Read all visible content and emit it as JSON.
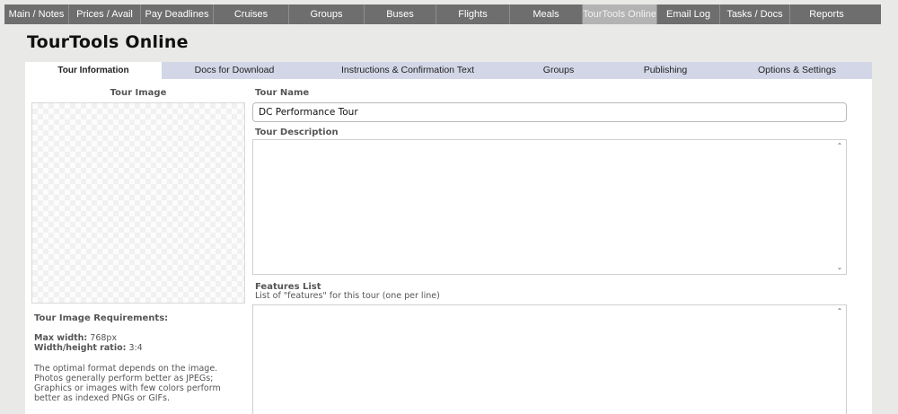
{
  "topnav": [
    {
      "label": "Main / Notes",
      "active": false
    },
    {
      "label": "Prices / Avail",
      "active": false
    },
    {
      "label": "Pay Deadlines",
      "active": false
    },
    {
      "label": "Cruises",
      "active": false
    },
    {
      "label": "Groups",
      "active": false
    },
    {
      "label": "Buses",
      "active": false
    },
    {
      "label": "Flights",
      "active": false
    },
    {
      "label": "Meals",
      "active": false
    },
    {
      "label": "TourTools Online",
      "active": true
    },
    {
      "label": "Email Log",
      "active": false
    },
    {
      "label": "Tasks / Docs",
      "active": false
    },
    {
      "label": "Reports",
      "active": false
    }
  ],
  "page": {
    "title": "TourTools Online"
  },
  "subtabs": [
    {
      "label": "Tour Information",
      "active": true
    },
    {
      "label": "Docs for Download",
      "active": false
    },
    {
      "label": "Instructions & Confirmation Text",
      "active": false
    },
    {
      "label": "Groups",
      "active": false
    },
    {
      "label": "Publishing",
      "active": false
    },
    {
      "label": "Options & Settings",
      "active": false
    }
  ],
  "tour_image": {
    "title": "Tour Image",
    "requirements_title": "Tour Image Requirements:",
    "max_width_label": "Max width:",
    "max_width_value": "768px",
    "ratio_label": "Width/height ratio:",
    "ratio_value": "3:4",
    "note": "The optimal format depends on the image. Photos generally perform better as JPEGs; Graphics or images with few colors perform better as indexed PNGs or GIFs."
  },
  "form": {
    "name_label": "Tour Name",
    "name_value": "DC Performance Tour",
    "description_label": "Tour Description",
    "description_value": "",
    "features_label": "Features List",
    "features_sublabel": "List of \"features\" for this tour (one per line)",
    "features_value": ""
  },
  "colors": {
    "nav_bg": "#6e6e6e",
    "nav_active": "#b3b3b3",
    "subtab_bg": "#d2d6e6",
    "page_bg": "#e9e9e7"
  }
}
